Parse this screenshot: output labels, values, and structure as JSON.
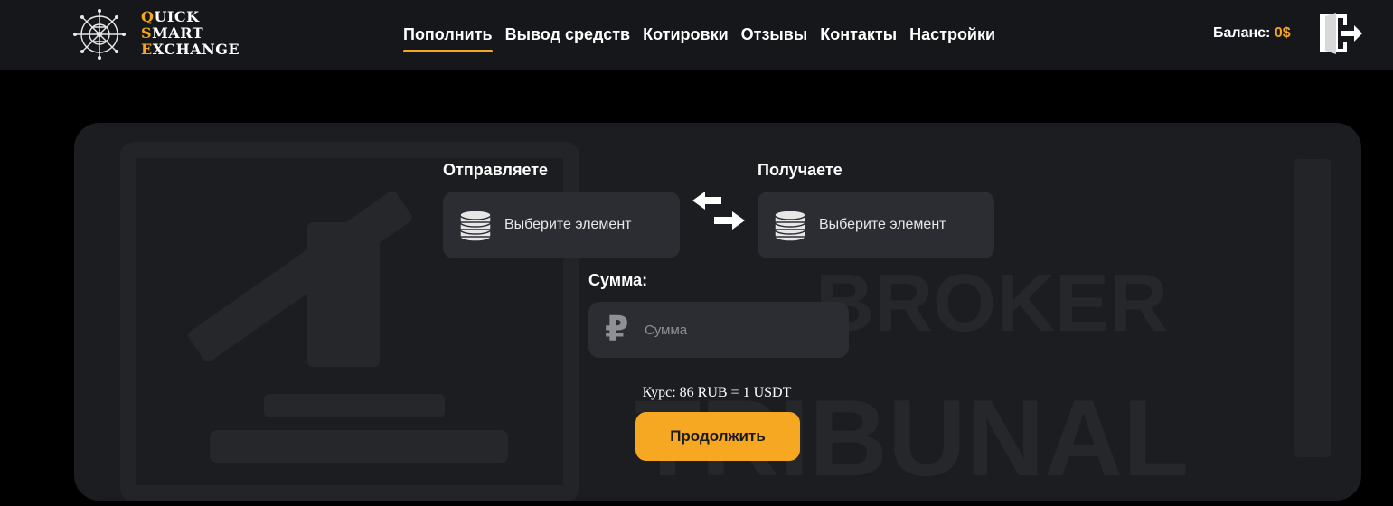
{
  "header": {
    "logo": {
      "line1": {
        "cap": "Q",
        "rest": "UICK"
      },
      "line2": {
        "cap": "S",
        "rest": "MART"
      },
      "line3": {
        "cap": "E",
        "rest": "XCHANGE"
      }
    },
    "nav": [
      {
        "label": "Пополнить",
        "active": true
      },
      {
        "label": "Вывод средств"
      },
      {
        "label": "Котировки"
      },
      {
        "label": "Отзывы"
      },
      {
        "label": "Контакты"
      },
      {
        "label": "Настройки"
      }
    ],
    "balance_label": "Баланс:",
    "balance_value": "0$",
    "logout_icon": "logout-door-icon"
  },
  "exchange": {
    "send_label": "Отправляете",
    "receive_label": "Получаете",
    "send_select": {
      "icon": "coin-stack-icon",
      "text": "Выберите элемент"
    },
    "receive_select": {
      "icon": "coin-stack-icon",
      "text": "Выберите элемент"
    },
    "swap_icon": "swap-arrows-icon",
    "amount_label": "Сумма:",
    "amount_symbol": "₽",
    "amount_placeholder": "Сумма",
    "rate_text": "Курс: 86 RUB = 1 USDT",
    "continue_label": "Продолжить"
  },
  "watermark": {
    "line1": "BROKER",
    "line2": "TRIBUNAL"
  },
  "colors": {
    "accent": "#f3a81f",
    "background": "#000000",
    "header": "#16171b",
    "card": "#1c1d21",
    "field": "#2c2d32"
  }
}
